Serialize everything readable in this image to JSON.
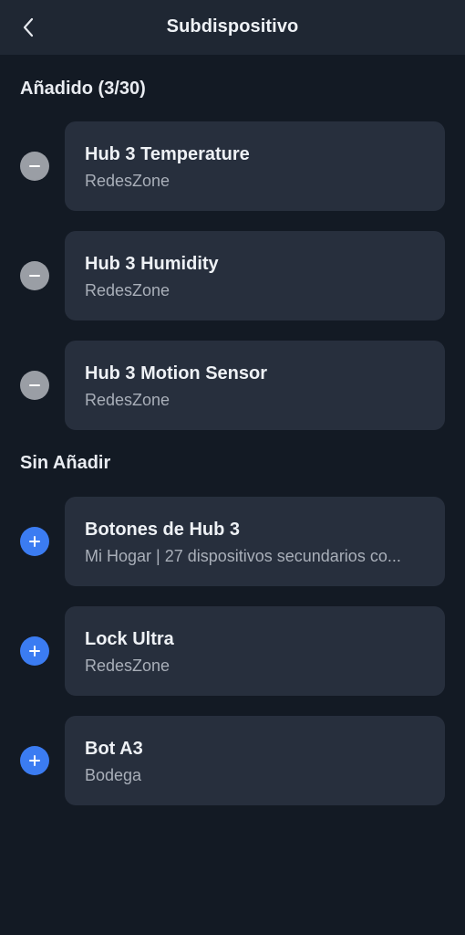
{
  "header": {
    "title": "Subdispositivo"
  },
  "added": {
    "title": "Añadido (3/30)",
    "items": [
      {
        "name": "Hub 3 Temperature",
        "subtitle": "RedesZone"
      },
      {
        "name": "Hub 3 Humidity",
        "subtitle": "RedesZone"
      },
      {
        "name": "Hub 3 Motion Sensor",
        "subtitle": "RedesZone"
      }
    ]
  },
  "not_added": {
    "title": "Sin Añadir",
    "items": [
      {
        "name": "Botones de Hub 3",
        "subtitle": "Mi Hogar | 27 dispositivos secundarios co..."
      },
      {
        "name": "Lock Ultra",
        "subtitle": "RedesZone"
      },
      {
        "name": "Bot A3",
        "subtitle": "Bodega"
      }
    ]
  },
  "colors": {
    "background": "#131a24",
    "header": "#1f2733",
    "card": "#272f3d",
    "remove_button": "#9a9ea5",
    "add_button": "#3b7cf2"
  },
  "icons": {
    "back": "chevron-left-icon",
    "remove": "minus-icon",
    "add": "plus-icon"
  }
}
